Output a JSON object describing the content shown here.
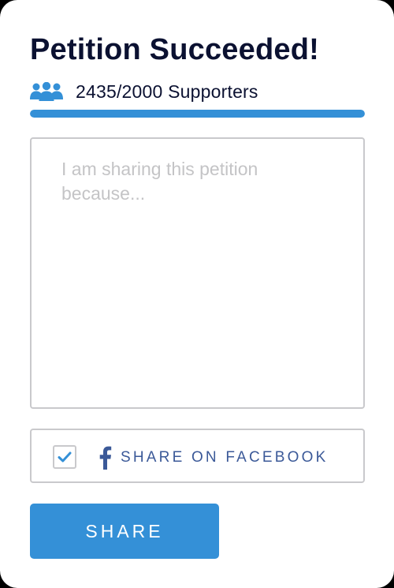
{
  "petition": {
    "title": "Petition Succeeded!",
    "supporters_text": "2435/2000 Supporters",
    "supporters_count": 2435,
    "supporters_goal": 2000,
    "progress_fraction": 1.0
  },
  "message": {
    "placeholder": "I am sharing this petition because...",
    "value": ""
  },
  "facebook": {
    "checked": true,
    "label": "SHARE ON FACEBOOK"
  },
  "share_button": {
    "label": "SHARE"
  },
  "colors": {
    "accent": "#3490d7",
    "title_text": "#0b1131",
    "facebook_blue": "#3b5998",
    "border": "#c9c9cc",
    "placeholder": "#c4c4c6"
  },
  "icons": {
    "supporters": "people-group-icon",
    "checkbox": "checkmark-icon",
    "facebook": "facebook-icon"
  }
}
